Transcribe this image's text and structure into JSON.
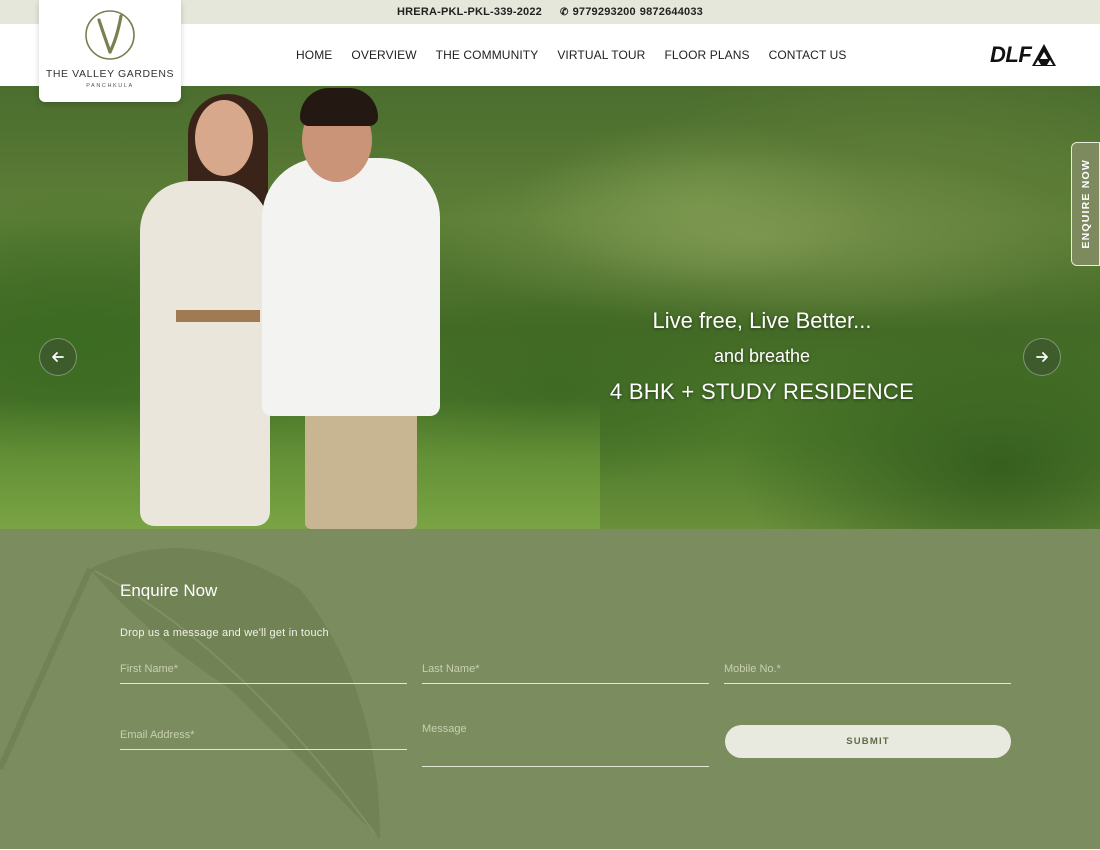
{
  "topbar": {
    "rera": "HRERA-PKL-PKL-339-2022",
    "phone_icon": "phone-icon",
    "phone1": "9779293200",
    "phone2": "9872644033"
  },
  "logo": {
    "title": "THE VALLEY GARDENS",
    "subtitle": "PANCHKULA"
  },
  "nav": {
    "items": [
      {
        "label": "HOME"
      },
      {
        "label": "OVERVIEW"
      },
      {
        "label": "THE COMMUNITY"
      },
      {
        "label": "VIRTUAL TOUR"
      },
      {
        "label": "FLOOR PLANS"
      },
      {
        "label": "CONTACT US"
      }
    ]
  },
  "brand": {
    "dlf": "DLF"
  },
  "hero": {
    "line1": "Live free, Live Better...",
    "line2": "and breathe",
    "line3": "4 BHK + STUDY RESIDENCE",
    "prev_icon": "arrow-left-icon",
    "next_icon": "arrow-right-icon"
  },
  "side_tab": {
    "label": "ENQUIRE NOW"
  },
  "enquiry": {
    "title": "Enquire Now",
    "subtitle": "Drop us a message and we'll get in touch",
    "first_name_placeholder": "First Name*",
    "last_name_placeholder": "Last Name*",
    "mobile_placeholder": "Mobile No.*",
    "email_placeholder": "Email Address*",
    "message_placeholder": "Message",
    "submit_label": "SUBMIT"
  },
  "colors": {
    "section_green": "#7b8c5e",
    "topbar_bg": "#e4e7da",
    "submit_bg": "#e8eadf"
  }
}
